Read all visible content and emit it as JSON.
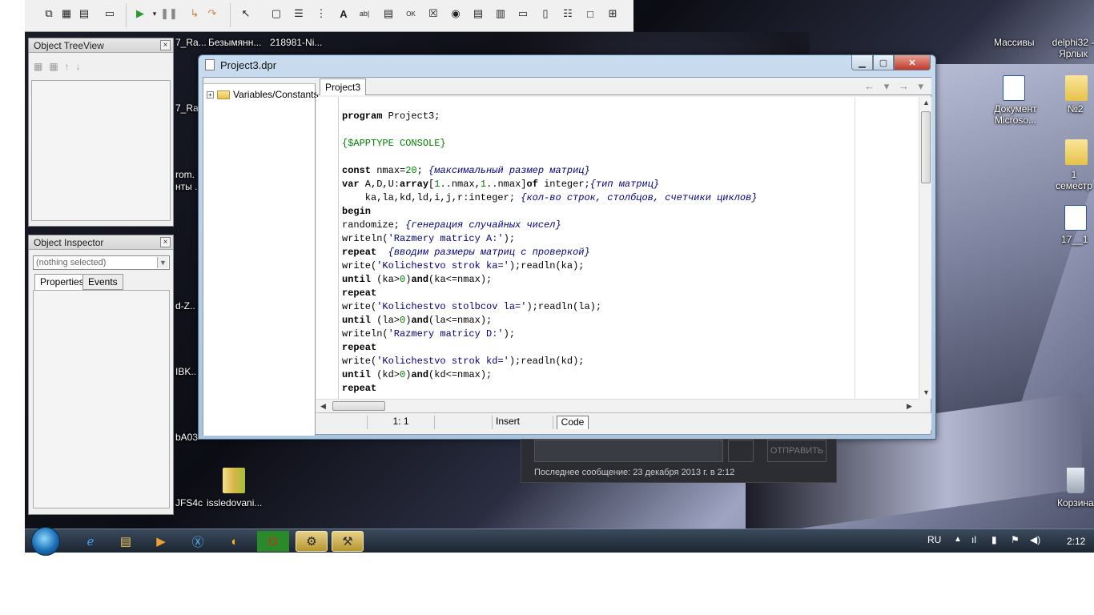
{
  "desktop": {
    "top_labels": [
      "7_Ra...",
      "Безымянн...",
      "218981-Ni..."
    ],
    "right_icons": [
      {
        "label": "Массивы"
      },
      {
        "label": "delphi32 - Ярлык"
      },
      {
        "label": "Документ Microso..."
      },
      {
        "label": "№2"
      },
      {
        "label": "1 семестр"
      },
      {
        "label": "17__1"
      },
      {
        "label": "Корзина"
      }
    ],
    "left_partial_labels": [
      "7_Ra",
      "rom.",
      "нты .",
      "d-Z..",
      "IBK..",
      "bA03",
      "JFS4c"
    ],
    "bottom_icon": {
      "label": "issledovani..."
    }
  },
  "treeview": {
    "title": "Object TreeView"
  },
  "inspector": {
    "title": "Object Inspector",
    "selected": "(nothing selected)",
    "tabs": [
      "Properties",
      "Events"
    ]
  },
  "editor": {
    "window_title": "Project3.dpr",
    "explorer_node": "Variables/Constants",
    "active_tab": "Project3",
    "status": {
      "position": "1:  1",
      "modified": "",
      "mode": "Insert",
      "view": "Code"
    },
    "lines": [
      [
        {
          "t": "program",
          "c": "kw"
        },
        {
          "t": " Project3;",
          "c": ""
        }
      ],
      [],
      [
        {
          "t": "{$APPTYPE CONSOLE}",
          "c": "dir"
        }
      ],
      [],
      [
        {
          "t": "const",
          "c": "kw"
        },
        {
          "t": " nmax=",
          "c": ""
        },
        {
          "t": "20",
          "c": "num"
        },
        {
          "t": "; ",
          "c": ""
        },
        {
          "t": "{максимальный размер матриц}",
          "c": "cmt"
        }
      ],
      [
        {
          "t": "var",
          "c": "kw"
        },
        {
          "t": " A,D,U:",
          "c": ""
        },
        {
          "t": "array",
          "c": "kw"
        },
        {
          "t": "[",
          "c": ""
        },
        {
          "t": "1",
          "c": "num"
        },
        {
          "t": "..nmax,",
          "c": ""
        },
        {
          "t": "1",
          "c": "num"
        },
        {
          "t": "..nmax]",
          "c": ""
        },
        {
          "t": "of",
          "c": "kw"
        },
        {
          "t": " integer;",
          "c": ""
        },
        {
          "t": "{тип матриц}",
          "c": "cmt"
        }
      ],
      [
        {
          "t": "    ka,la,kd,ld,i,j,r:integer; ",
          "c": ""
        },
        {
          "t": "{кол-во строк, столбцов, счетчики циклов}",
          "c": "cmt"
        }
      ],
      [
        {
          "t": "begin",
          "c": "kw"
        }
      ],
      [
        {
          "t": "randomize; ",
          "c": ""
        },
        {
          "t": "{генерация случайных чисел}",
          "c": "cmt"
        }
      ],
      [
        {
          "t": "writeln(",
          "c": ""
        },
        {
          "t": "'Razmery matricy A:'",
          "c": "str"
        },
        {
          "t": ");",
          "c": ""
        }
      ],
      [
        {
          "t": "repeat",
          "c": "kw"
        },
        {
          "t": "  ",
          "c": ""
        },
        {
          "t": "{вводим размеры матриц с проверкой}",
          "c": "cmt"
        }
      ],
      [
        {
          "t": "write(",
          "c": ""
        },
        {
          "t": "'Kolichestvo strok ka='",
          "c": "str"
        },
        {
          "t": ");readln(ka);",
          "c": ""
        }
      ],
      [
        {
          "t": "until",
          "c": "kw"
        },
        {
          "t": " (ka>",
          "c": ""
        },
        {
          "t": "0",
          "c": "num"
        },
        {
          "t": ")",
          "c": ""
        },
        {
          "t": "and",
          "c": "kw"
        },
        {
          "t": "(ka<=nmax);",
          "c": ""
        }
      ],
      [
        {
          "t": "repeat",
          "c": "kw"
        }
      ],
      [
        {
          "t": "write(",
          "c": ""
        },
        {
          "t": "'Kolichestvo stolbcov la='",
          "c": "str"
        },
        {
          "t": ");readln(la);",
          "c": ""
        }
      ],
      [
        {
          "t": "until",
          "c": "kw"
        },
        {
          "t": " (la>",
          "c": ""
        },
        {
          "t": "0",
          "c": "num"
        },
        {
          "t": ")",
          "c": ""
        },
        {
          "t": "and",
          "c": "kw"
        },
        {
          "t": "(la<=nmax);",
          "c": ""
        }
      ],
      [
        {
          "t": "writeln(",
          "c": ""
        },
        {
          "t": "'Razmery matricy D:'",
          "c": "str"
        },
        {
          "t": ");",
          "c": ""
        }
      ],
      [
        {
          "t": "repeat",
          "c": "kw"
        }
      ],
      [
        {
          "t": "write(",
          "c": ""
        },
        {
          "t": "'Kolichestvo strok kd='",
          "c": "str"
        },
        {
          "t": ");readln(kd);",
          "c": ""
        }
      ],
      [
        {
          "t": "until",
          "c": "kw"
        },
        {
          "t": " (kd>",
          "c": ""
        },
        {
          "t": "0",
          "c": "num"
        },
        {
          "t": ")",
          "c": ""
        },
        {
          "t": "and",
          "c": "kw"
        },
        {
          "t": "(kd<=nmax);",
          "c": ""
        }
      ],
      [
        {
          "t": "repeat",
          "c": "kw"
        }
      ]
    ]
  },
  "chat": {
    "send_label": "ОТПРАВИТЬ",
    "last_message": "Последнее сообщение: 23 декабря 2013 г. в 2:12"
  },
  "taskbar": {
    "language": "RU",
    "clock": "2:12"
  }
}
